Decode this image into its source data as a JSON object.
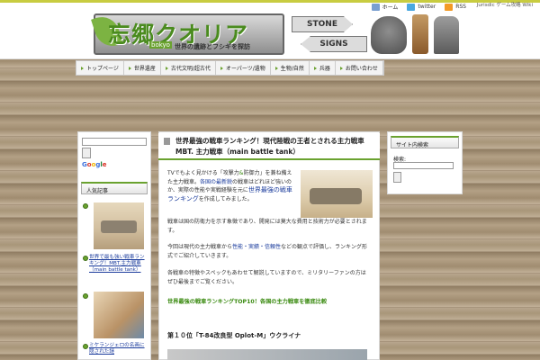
{
  "colors": {
    "accent": "#6aa22f",
    "link": "#1a3b9c"
  },
  "header": {
    "topright": "Jurisdic ゲーム攻略 Wiki",
    "links": [
      {
        "icon": "home-icon",
        "label": "ホーム"
      },
      {
        "icon": "twitter-icon",
        "label": "twitter"
      },
      {
        "icon": "rss-icon",
        "label": "RSS"
      }
    ],
    "logo_title": "忘郷クオリア",
    "logo_romaji": "bokyo",
    "logo_sub": "世界の遺跡とフシギを探訪",
    "sign1": "STONE",
    "sign2": "SIGNS"
  },
  "nav": [
    "トップページ",
    "世界遺産",
    "古代文明/超古代",
    "オーパーツ/遺物",
    "生物/自然",
    "兵器",
    "お問い合わせ"
  ],
  "left": {
    "search_placeholder": "",
    "google": [
      "G",
      "o",
      "o",
      "g",
      "l",
      "e"
    ],
    "section_title": "人気記事",
    "items": [
      "世界で最も強い戦車ランキング！MBT.主力戦車（main battle tank）",
      "ミケランジェロの名画に隠された謎"
    ]
  },
  "article": {
    "title": "世界最強の戦車ランキング！現代陸戦の王者とされる主力戦車MBT. 主力戦車（main battle tank）",
    "p1_a": "TVでもよく見かける「攻撃力",
    "p1_hl1": "&",
    "p1_b": "防御力」を兼ね備えた主力戦車。",
    "p1_c": "各国の最新鋭",
    "p1_d": "の戦車はどれほど強いのか、実際の性能や実戦経験を元に",
    "p1_hl2": "世界最強の戦車ランキング",
    "p1_e": "を作成してみました。",
    "p2": "戦車は国の防衛力を示す象徴であり、開発には莫大な費用と技術力が必要とされます。",
    "p3_a": "今回は現代の主力戦車から",
    "p3_hl": "性能・実績・信頼性",
    "p3_b": "などの観点で評価し、ランキング形式でご紹介していきます。",
    "p4": "各戦車の特徴やスペックもあわせて解説していますので、ミリタリーファンの方はぜひ最後までご覧ください。",
    "link_line": "世界最強の戦車ランキングTOP10！各国の主力戦車を徹底比較",
    "subhead": "第１０位「T-84改良型 Oplot-M」ウクライナ"
  },
  "right": {
    "section_title": "サイト内検索",
    "label": "検索:",
    "input_value": ""
  }
}
